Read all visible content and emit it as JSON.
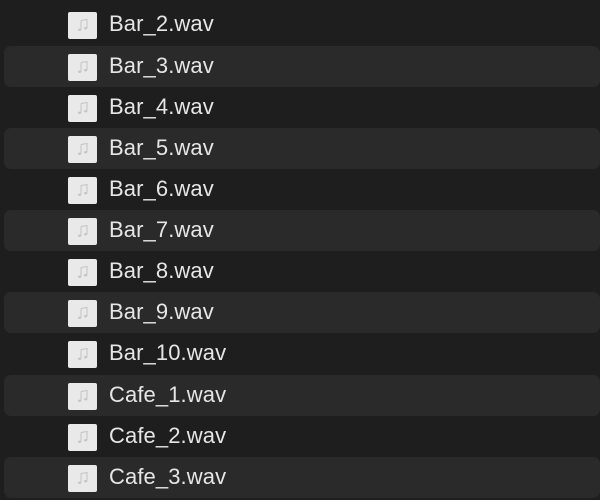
{
  "file_list": {
    "items": [
      {
        "name": "Bar_2.wav",
        "icon": "audio-file-icon"
      },
      {
        "name": "Bar_3.wav",
        "icon": "audio-file-icon"
      },
      {
        "name": "Bar_4.wav",
        "icon": "audio-file-icon"
      },
      {
        "name": "Bar_5.wav",
        "icon": "audio-file-icon"
      },
      {
        "name": "Bar_6.wav",
        "icon": "audio-file-icon"
      },
      {
        "name": "Bar_7.wav",
        "icon": "audio-file-icon"
      },
      {
        "name": "Bar_8.wav",
        "icon": "audio-file-icon"
      },
      {
        "name": "Bar_9.wav",
        "icon": "audio-file-icon"
      },
      {
        "name": "Bar_10.wav",
        "icon": "audio-file-icon"
      },
      {
        "name": "Cafe_1.wav",
        "icon": "audio-file-icon"
      },
      {
        "name": "Cafe_2.wav",
        "icon": "audio-file-icon"
      },
      {
        "name": "Cafe_3.wav",
        "icon": "audio-file-icon"
      }
    ]
  },
  "colors": {
    "background": "#1e1e1e",
    "alternate_row": "#2a2a2a",
    "text": "#e6e6e6",
    "icon_paper": "#e9e9e9",
    "icon_glyph": "#c4c4c4"
  }
}
